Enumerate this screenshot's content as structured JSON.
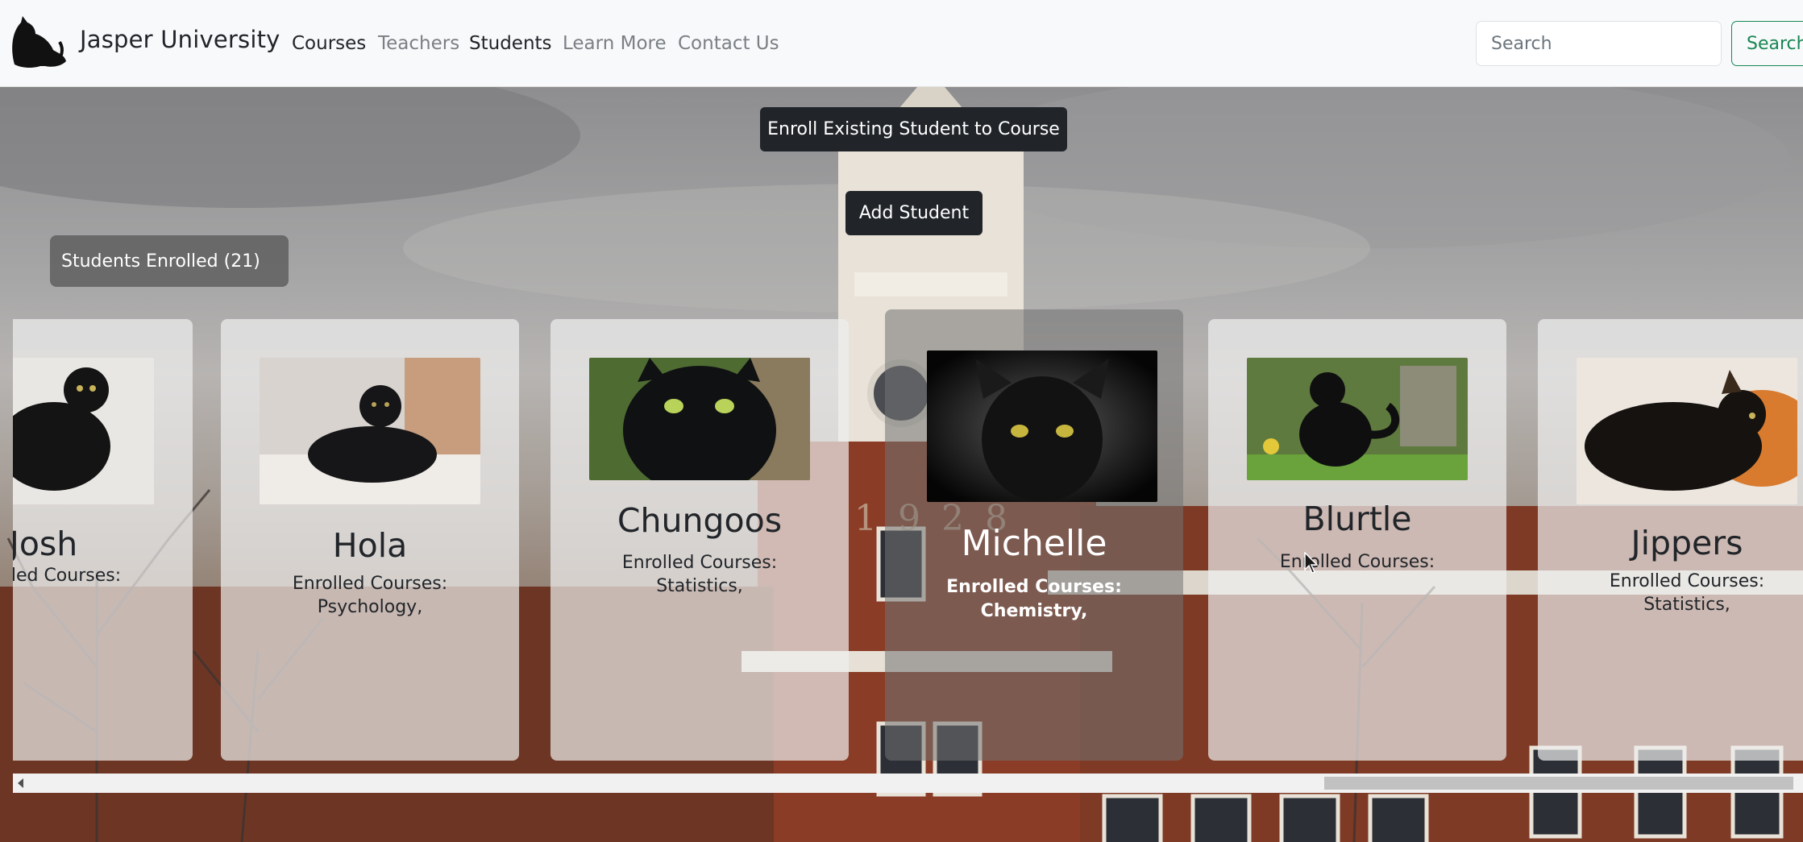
{
  "navbar": {
    "brand": "Jasper University",
    "links": [
      "Courses",
      "Teachers",
      "Students",
      "Learn More",
      "Contact Us"
    ],
    "search_placeholder": "Search",
    "search_button": "Search"
  },
  "actions": {
    "enroll_button": "Enroll Existing Student to Course",
    "add_button": "Add Student",
    "students_badge": "Students Enrolled (21)"
  },
  "students": [
    {
      "name": "Josh",
      "courses_label": "Enrolled Courses:",
      "courses": ""
    },
    {
      "name": "Hola",
      "courses_label": "Enrolled Courses:",
      "courses": "Psychology,"
    },
    {
      "name": "Chungoos",
      "courses_label": "Enrolled Courses:",
      "courses": "Statistics,"
    },
    {
      "name": "Michelle",
      "courses_label": "Enrolled Courses:",
      "courses": "Chemistry,"
    },
    {
      "name": "Blurtle",
      "courses_label": "Enrolled Courses:",
      "courses": ""
    },
    {
      "name": "Jippers",
      "courses_label": "Enrolled Courses:",
      "courses": "Statistics,"
    }
  ],
  "background_clock_text": "1928",
  "colors": {
    "navbar_bg": "#f8f9fa",
    "dark_button": "#212529",
    "search_outline": "#198754"
  }
}
